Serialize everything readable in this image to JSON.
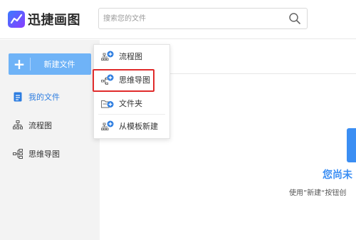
{
  "app": {
    "title": "迅捷画图"
  },
  "search": {
    "placeholder": "搜索您的文件"
  },
  "sidebar": {
    "new_button_label": "新建文件",
    "items": [
      {
        "label": "我的文件",
        "icon": "file-icon",
        "active": true
      },
      {
        "label": "流程图",
        "icon": "flowchart-icon",
        "active": false
      },
      {
        "label": "思维导图",
        "icon": "mindmap-icon",
        "active": false
      }
    ]
  },
  "menu": {
    "items": [
      {
        "label": "流程图",
        "icon": "flowchart-add-icon"
      },
      {
        "label": "思维导图",
        "icon": "mindmap-add-icon",
        "highlighted": true
      },
      {
        "label": "文件夹",
        "icon": "folder-add-icon"
      },
      {
        "label": "从模板新建",
        "icon": "template-add-icon"
      }
    ]
  },
  "main": {
    "empty_title": "您尚未",
    "empty_desc": "使用”新建“按钮创"
  },
  "colors": {
    "accent": "#3b8ef3",
    "new_button": "#6fb3f7",
    "highlight": "#e02b2b",
    "sidebar_bg": "#f3f3f3"
  }
}
